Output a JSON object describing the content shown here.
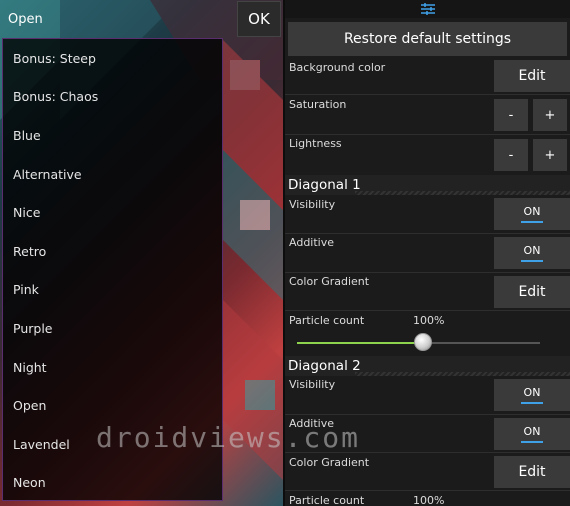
{
  "left": {
    "current_selection": "Open",
    "ok_label": "OK",
    "items": [
      "Bonus: Steep",
      "Bonus: Chaos",
      "Blue",
      "Alternative",
      "Nice",
      "Retro",
      "Pink",
      "Purple",
      "Night",
      "Open",
      "Lavendel",
      "Neon"
    ]
  },
  "right": {
    "restore_label": "Restore default settings",
    "background_color_label": "Background color",
    "edit_label": "Edit",
    "saturation_label": "Saturation",
    "lightness_label": "Lightness",
    "minus_label": "-",
    "plus_label": "+",
    "diagonal1": {
      "title": "Diagonal 1",
      "visibility_label": "Visibility",
      "visibility_value": "ON",
      "additive_label": "Additive",
      "additive_value": "ON",
      "color_gradient_label": "Color Gradient",
      "edit_label": "Edit",
      "particle_label": "Particle count",
      "particle_value": "100%",
      "particle_fraction": 1.0
    },
    "diagonal2": {
      "title": "Diagonal 2",
      "visibility_label": "Visibility",
      "visibility_value": "ON",
      "additive_label": "Additive",
      "additive_value": "ON",
      "color_gradient_label": "Color Gradient",
      "edit_label": "Edit",
      "particle_label": "Particle count",
      "particle_value": "100%"
    }
  },
  "watermark": "droidviews.com",
  "colors": {
    "toggle_accent": "#3fa2e8",
    "slider_fill": "#8ed34d",
    "list_border": "#5a2e6e"
  },
  "icons": {
    "settings": "sliders-icon"
  }
}
